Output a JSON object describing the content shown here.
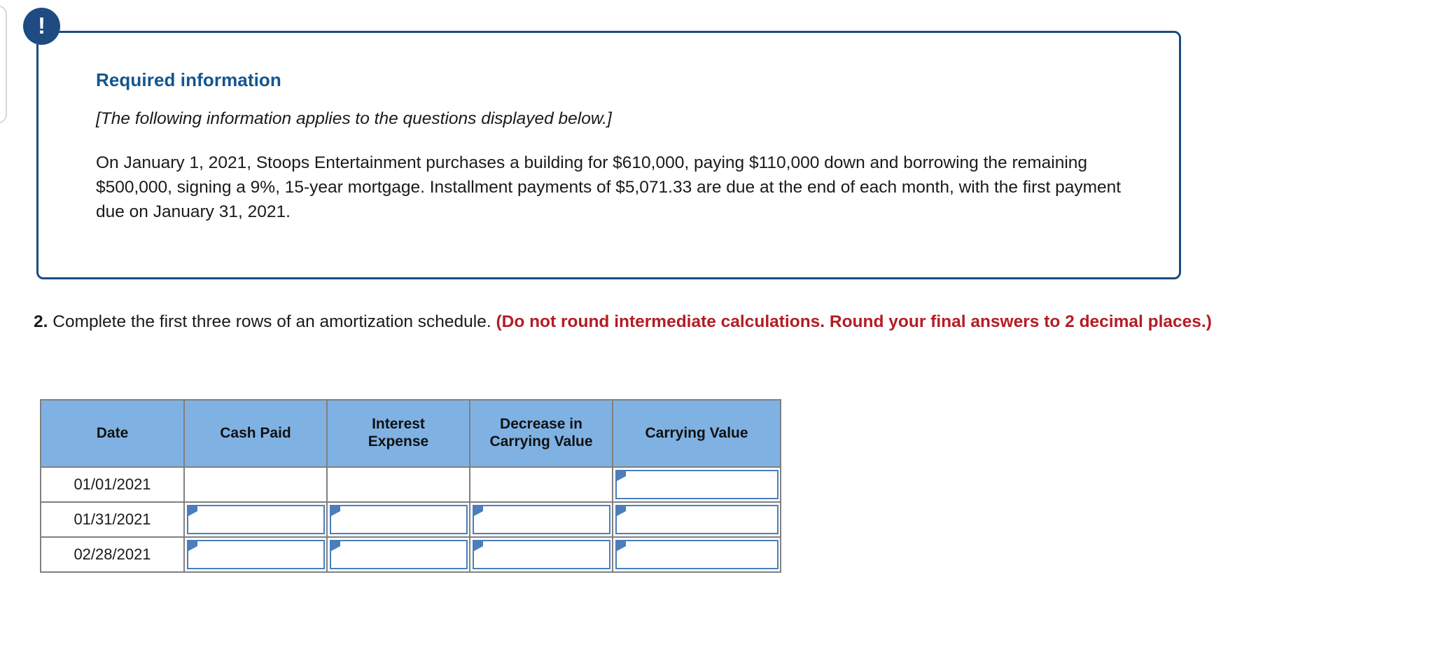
{
  "callout": {
    "icon": "exclamation-icon",
    "icon_glyph": "!",
    "title": "Required information",
    "italic_note": "[The following information applies to the questions displayed below.]",
    "paragraph": "On January 1, 2021, Stoops Entertainment purchases a building for $610,000, paying $110,000 down and borrowing the remaining $500,000, signing a 9%, 15-year mortgage. Installment payments of $5,071.33 are due at the end of each month, with the first payment due on January 31, 2021.",
    "border_color": "#1c4b82",
    "title_color": "#15558f"
  },
  "question": {
    "number": "2.",
    "text": " Complete the first three rows of an amortization schedule. ",
    "instruction": "(Do not round intermediate calculations. Round your final answers to 2 decimal places.)",
    "instruction_color": "#b51c23"
  },
  "table": {
    "header_bg": "#7fb2e3",
    "border_color": "#808080",
    "input_border_color": "#4a7ebc",
    "columns": [
      "Date",
      "Cash Paid",
      "Interest Expense",
      "Decrease in Carrying Value",
      "Carrying Value"
    ],
    "columns_lines": [
      [
        "Date"
      ],
      [
        "Cash Paid"
      ],
      [
        "Interest",
        "Expense"
      ],
      [
        "Decrease in",
        "Carrying Value"
      ],
      [
        "Carrying Value"
      ]
    ],
    "rows": [
      {
        "date": "01/01/2021",
        "cash_paid": "",
        "interest_expense": "",
        "decrease_in_carrying_value": "",
        "carrying_value": "",
        "inputs": [
          false,
          false,
          false,
          true
        ]
      },
      {
        "date": "01/31/2021",
        "cash_paid": "",
        "interest_expense": "",
        "decrease_in_carrying_value": "",
        "carrying_value": "",
        "inputs": [
          true,
          true,
          true,
          true
        ]
      },
      {
        "date": "02/28/2021",
        "cash_paid": "",
        "interest_expense": "",
        "decrease_in_carrying_value": "",
        "carrying_value": "",
        "inputs": [
          true,
          true,
          true,
          true
        ]
      }
    ]
  }
}
